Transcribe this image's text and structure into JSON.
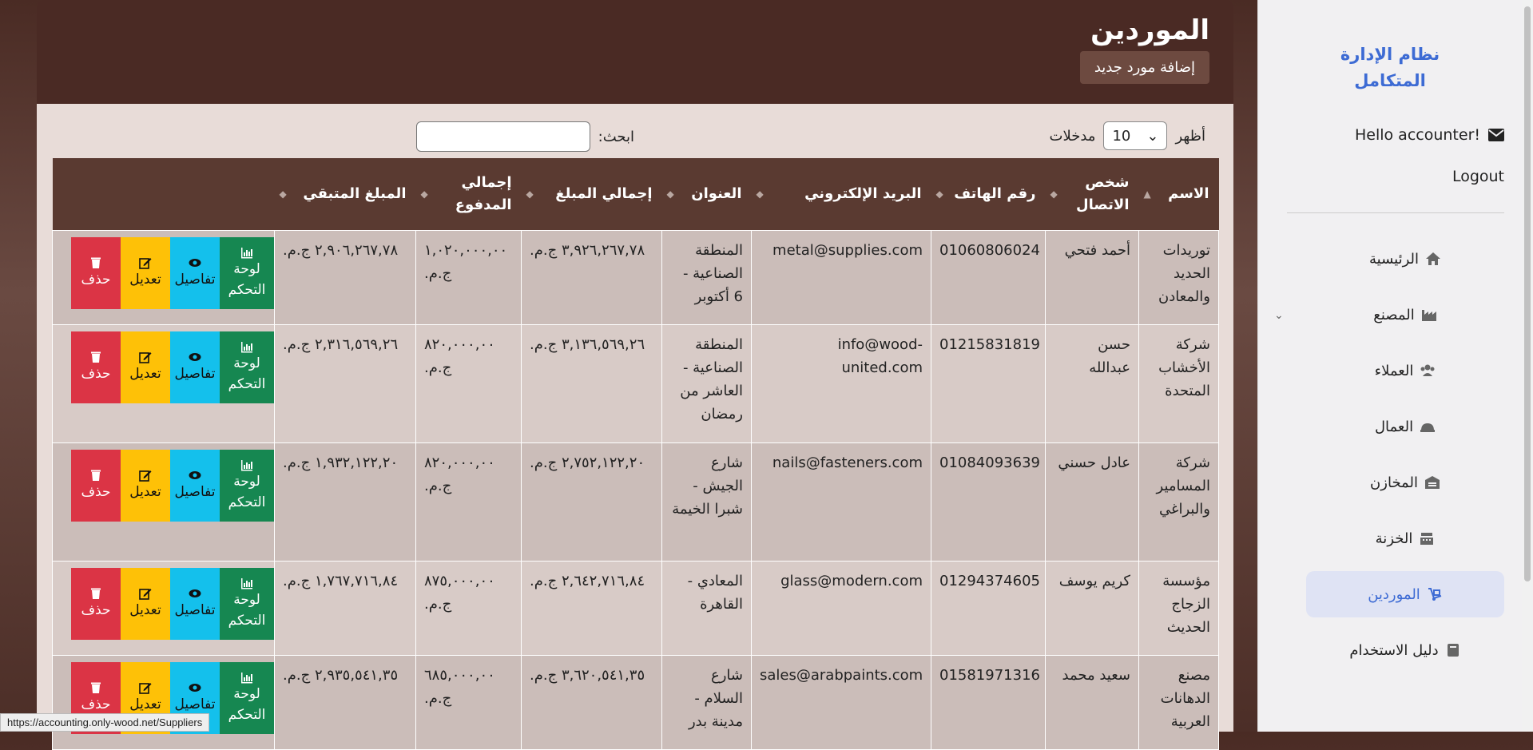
{
  "sidebar": {
    "brand_line1": "نظام الإدارة",
    "brand_line2": "المتكامل",
    "user": "Hello accounter!",
    "logout": "Logout",
    "items": [
      {
        "label": "الرئيسية",
        "icon": "home-icon"
      },
      {
        "label": "المصنع",
        "icon": "industry-icon"
      },
      {
        "label": "العملاء",
        "icon": "users-icon"
      },
      {
        "label": "العمال",
        "icon": "hard-hat-icon"
      },
      {
        "label": "المخازن",
        "icon": "warehouse-icon"
      },
      {
        "label": "الخزنة",
        "icon": "cash-register-icon"
      },
      {
        "label": "الموردين",
        "icon": "dolly-icon"
      },
      {
        "label": "دليل الاستخدام",
        "icon": "book-icon"
      }
    ]
  },
  "header": {
    "title": "الموردين",
    "add_button": "إضافة مورد جديد"
  },
  "controls": {
    "show_label": "أظهر",
    "entries_value": "10",
    "entries_label": "مدخلات",
    "search_label": "ابحث:"
  },
  "table": {
    "headers": {
      "name": "الاسم",
      "contact": "شخص الاتصال",
      "phone": "رقم الهاتف",
      "email": "البريد الإلكتروني",
      "address": "العنوان",
      "total": "إجمالي المبلغ",
      "paid": "إجمالي المدفوع",
      "remaining": "المبلغ المتبقي"
    },
    "buttons": {
      "dashboard": "لوحة التحكم",
      "details": "تفاصيل",
      "edit": "تعديل",
      "delete": "حذف"
    },
    "rows": [
      {
        "name": "توريدات الحديد والمعادن",
        "contact": "أحمد فتحي",
        "phone": "01060806024",
        "email": "metal@supplies.com",
        "address": "المنطقة الصناعية - 6 أكتوبر",
        "total": "٣,٩٢٦,٢٦٧,٧٨ ج.م.",
        "paid": "١,٠٢٠,٠٠٠,٠٠ ج.م.",
        "remaining": "٢,٩٠٦,٢٦٧,٧٨ ج.م."
      },
      {
        "name": "شركة الأخشاب المتحدة",
        "contact": "حسن عبدالله",
        "phone": "01215831819",
        "email": "info@wood-united.com",
        "address": "المنطقة الصناعية - العاشر من رمضان",
        "total": "٣,١٣٦,٥٦٩,٢٦ ج.م.",
        "paid": "٨٢٠,٠٠٠,٠٠ ج.م.",
        "remaining": "٢,٣١٦,٥٦٩,٢٦ ج.م."
      },
      {
        "name": "شركة المسامير والبراغي",
        "contact": "عادل حسني",
        "phone": "01084093639",
        "email": "nails@fasteners.com",
        "address": "شارع الجيش - شبرا الخيمة",
        "total": "٢,٧٥٢,١٢٢,٢٠ ج.م.",
        "paid": "٨٢٠,٠٠٠,٠٠ ج.م.",
        "remaining": "١,٩٣٢,١٢٢,٢٠ ج.م."
      },
      {
        "name": "مؤسسة الزجاج الحديث",
        "contact": "كريم يوسف",
        "phone": "01294374605",
        "email": "glass@modern.com",
        "address": "المعادي - القاهرة",
        "total": "٢,٦٤٢,٧١٦,٨٤ ج.م.",
        "paid": "٨٧٥,٠٠٠,٠٠ ج.م.",
        "remaining": "١,٧٦٧,٧١٦,٨٤ ج.م."
      },
      {
        "name": "مصنع الدهانات العربية",
        "contact": "سعيد محمد",
        "phone": "01581971316",
        "email": "sales@arabpaints.com",
        "address": "شارع السلام - مدينة بدر",
        "total": "٣,٦٢٠,٥٤١,٣٥ ج.م.",
        "paid": "٦٨٥,٠٠٠,٠٠ ج.م.",
        "remaining": "٢,٩٣٥,٥٤١,٣٥ ج.م."
      }
    ]
  },
  "status_url": "https://accounting.only-wood.net/Suppliers"
}
